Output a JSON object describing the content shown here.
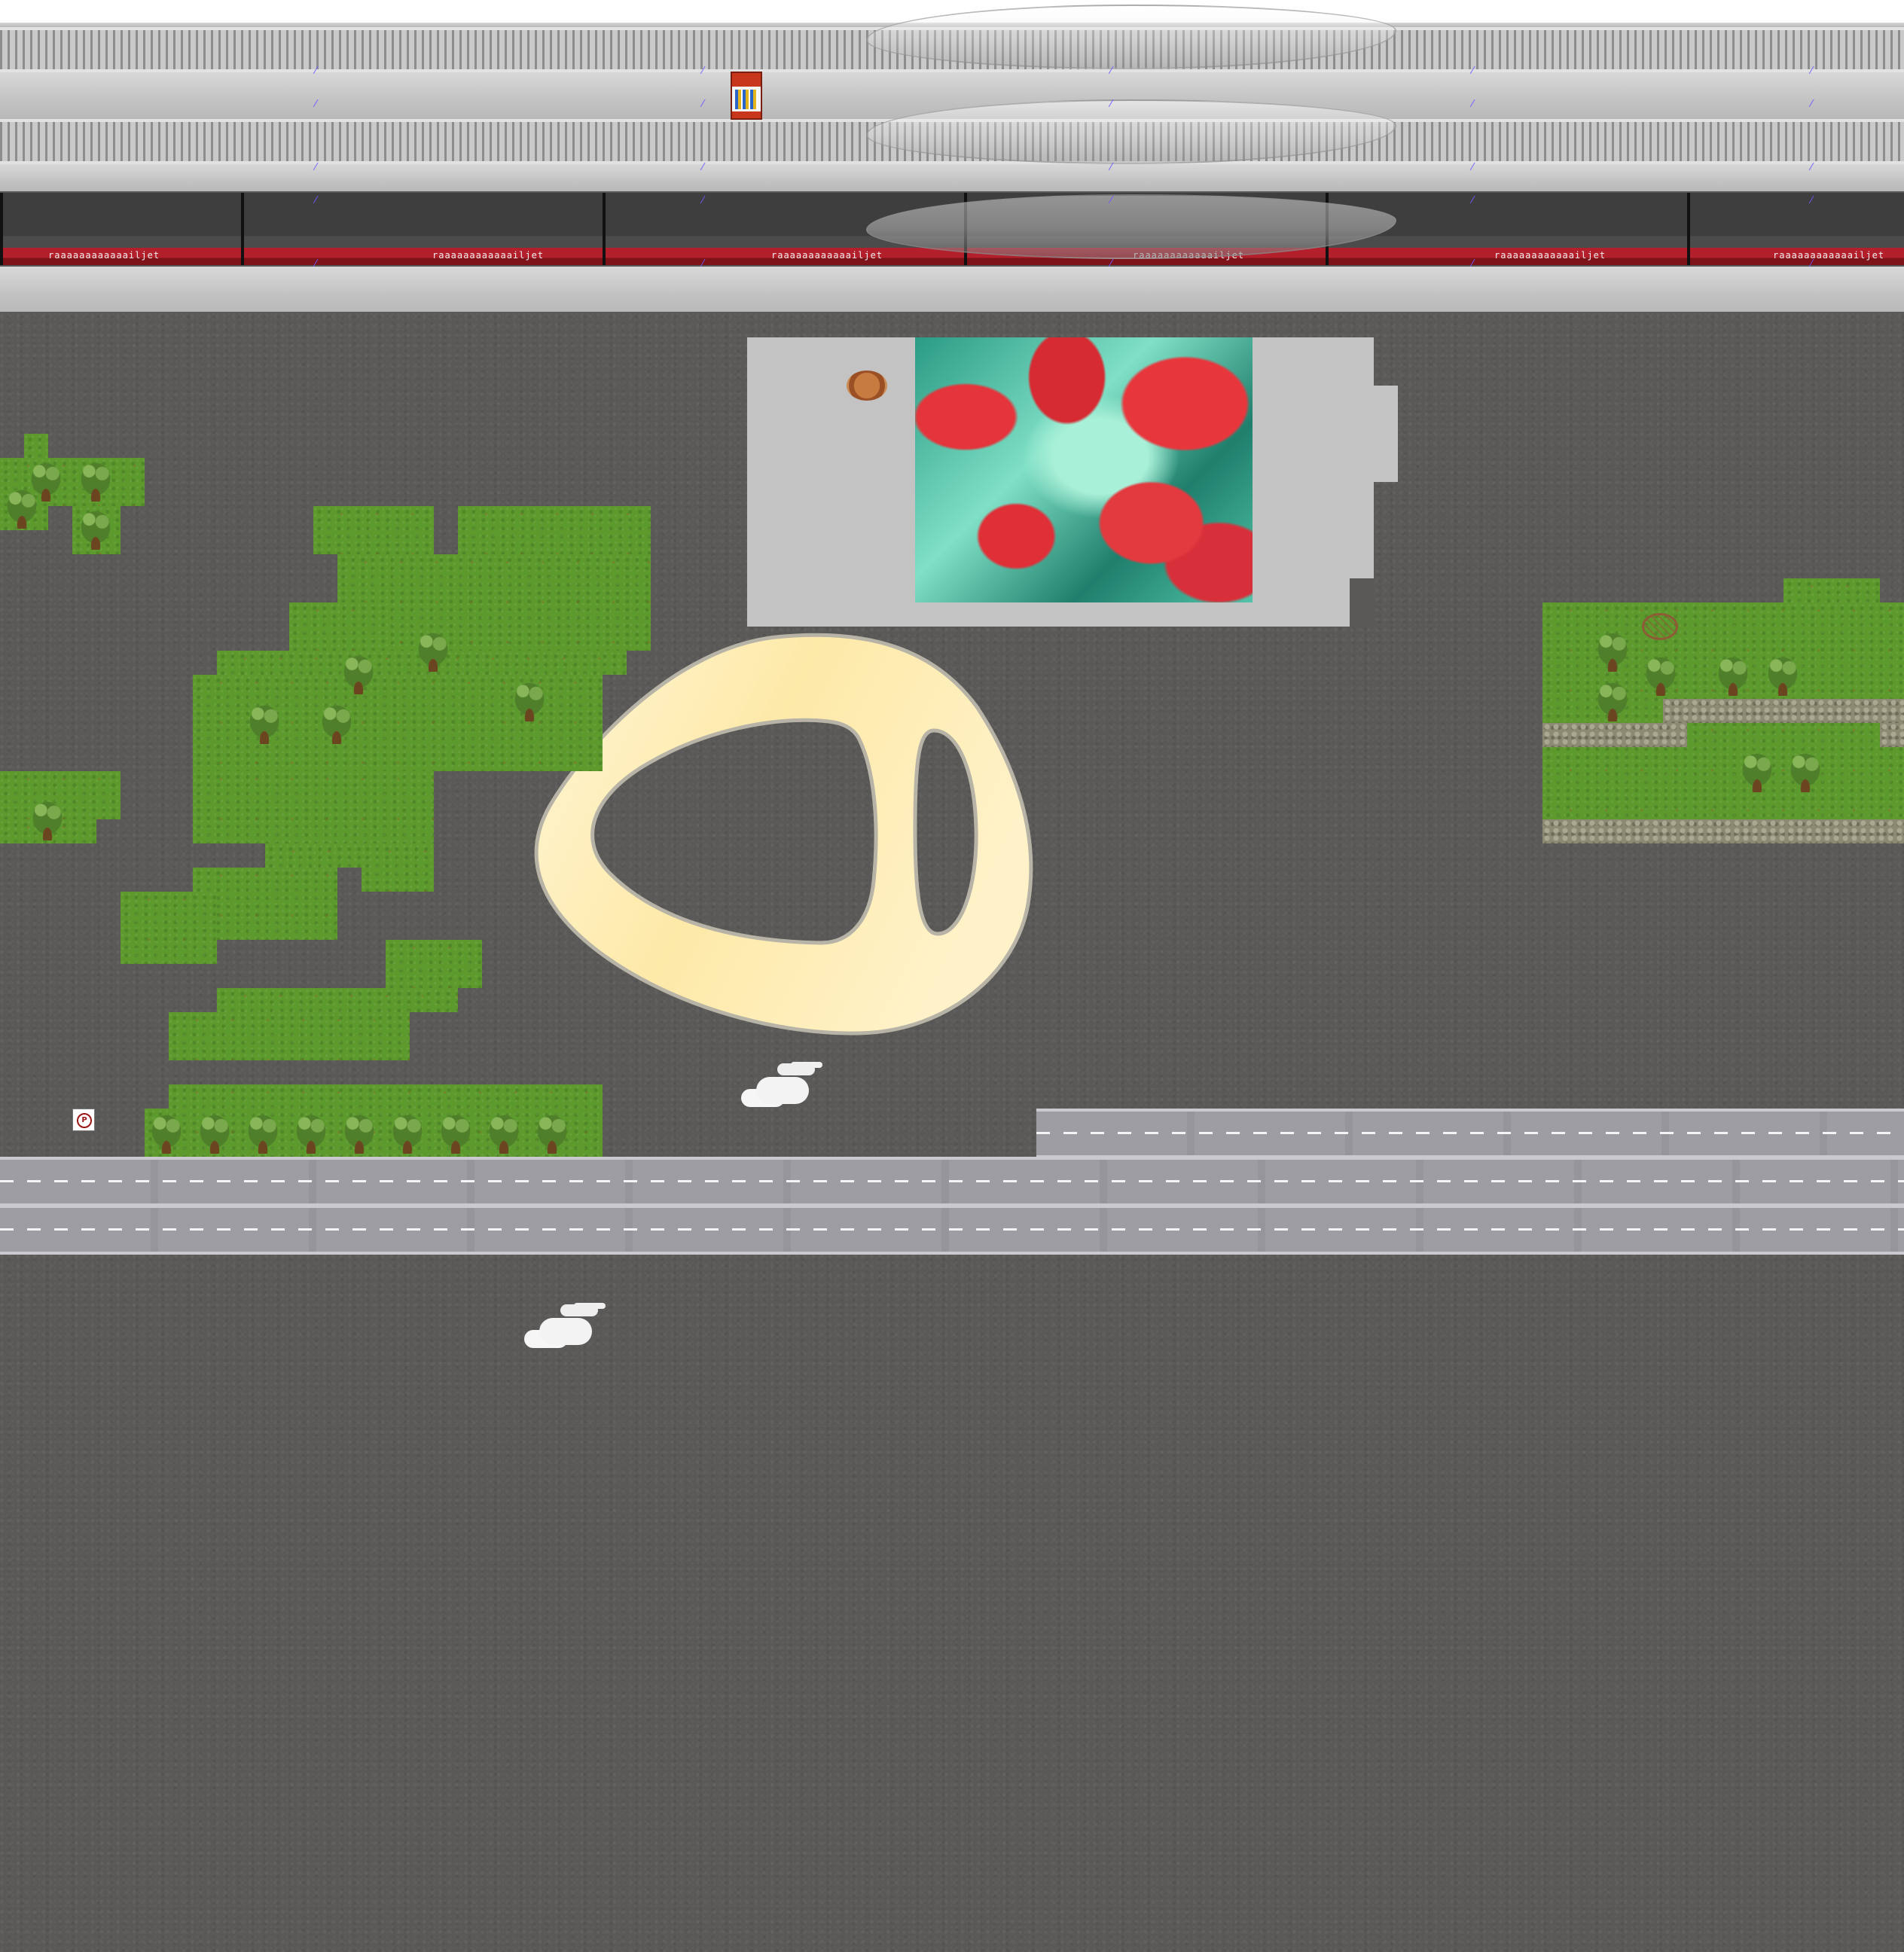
{
  "scene": {
    "train": {
      "car_label": "raaaaaaaaaaaailjet",
      "colors": {
        "body": "#3e3e3e",
        "stripe": "#b3202c"
      }
    },
    "icons": {
      "vending_machine": "vending-machine-icon",
      "pizza": "pizza-icon",
      "no_entry_sign": "no-entry-sign-icon",
      "smoke": "smoke-puff-icon",
      "tree": "tree-icon"
    },
    "sign": {
      "text": "P"
    },
    "colors": {
      "asphalt": "#5a5957",
      "grass": "#5c9a2d",
      "platform": "#c3c3c3",
      "road": "#9d9da3",
      "ring": "#fde9a8"
    }
  }
}
